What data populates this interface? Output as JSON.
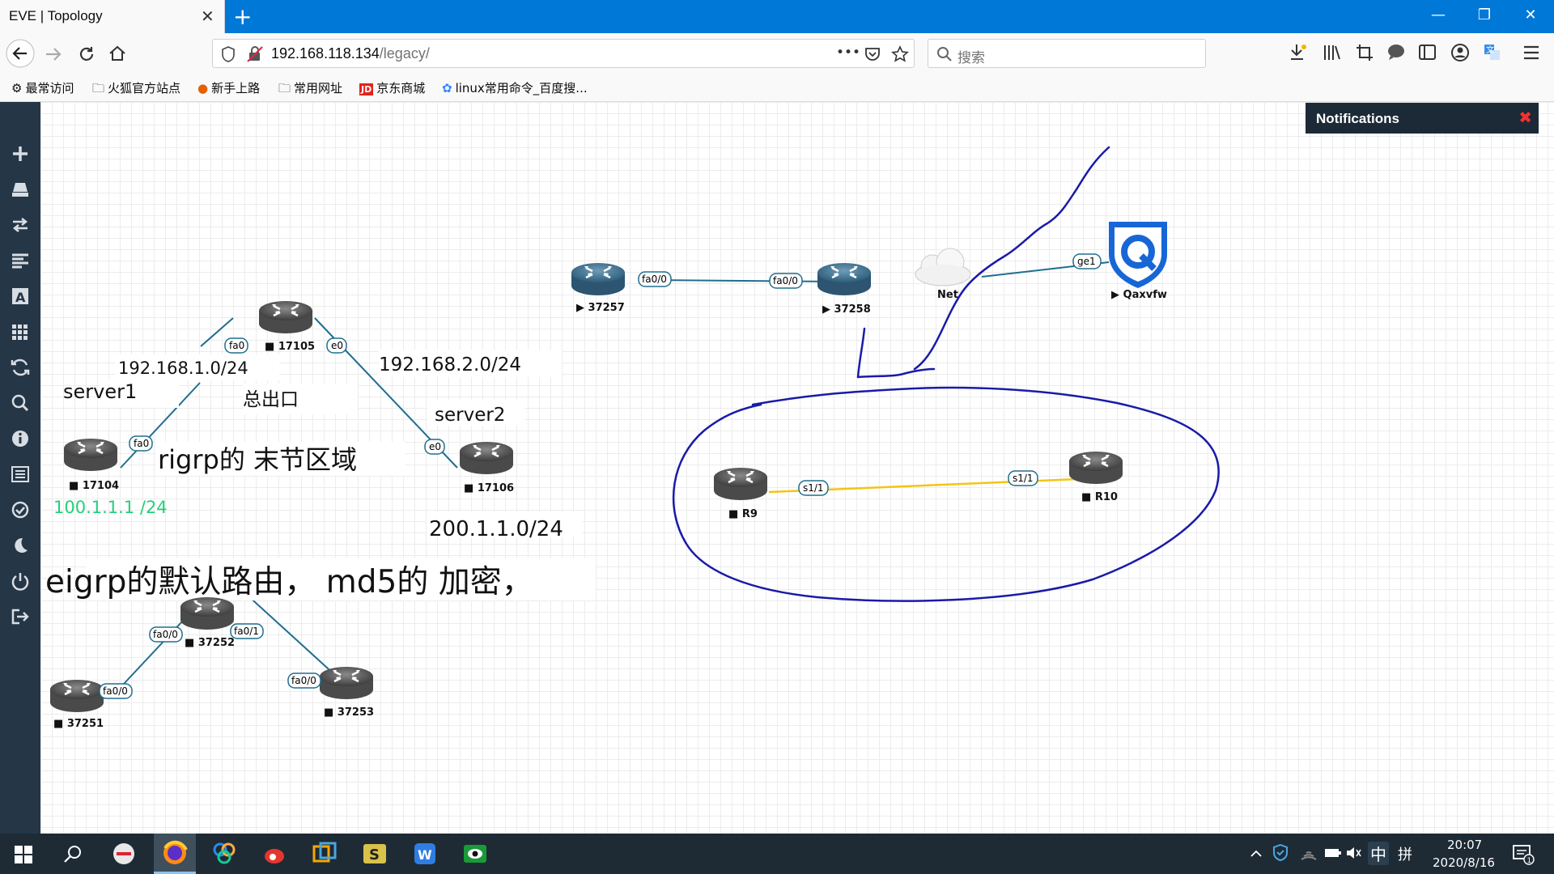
{
  "browser": {
    "tab_title": "EVE | Topology",
    "tab_close": "✕",
    "new_tab": "+",
    "url_host": "192.168.118.134",
    "url_path": "/legacy/",
    "url_more": "•••",
    "search_placeholder": "搜索",
    "window_minimize": "—",
    "window_restore": "❐",
    "window_close": "✕"
  },
  "bookmarks": [
    {
      "label": "最常访问",
      "icon": "gear-icon"
    },
    {
      "label": "火狐官方站点",
      "icon": "folder-icon"
    },
    {
      "label": "新手上路",
      "icon": "firefox-icon"
    },
    {
      "label": "常用网址",
      "icon": "folder-icon"
    },
    {
      "label": "京东商城",
      "icon": "jd-icon"
    },
    {
      "label": "linux常用命令_百度搜...",
      "icon": "baidu-paw-icon"
    }
  ],
  "notifications": {
    "title": "Notifications",
    "close": "✖"
  },
  "topology": {
    "nodes": {
      "n17105": "17105",
      "n17104": "17104",
      "n17106": "17106",
      "n37257": "37257",
      "n37258": "37258",
      "net": "Net",
      "qaxvfw": "Qaxvfw",
      "r9": "R9",
      "r10": "R10",
      "n37251": "37251",
      "n37252": "37252",
      "n37253": "37253"
    },
    "interfaces": {
      "fa0_17105": "fa0",
      "e0_17105": "e0",
      "fa0_17104": "fa0",
      "e0_17106": "e0",
      "fa00_37257": "fa0/0",
      "fa00_37258": "fa0/0",
      "ge1": "ge1",
      "s11_r9": "s1/1",
      "s11_r10": "s1/1",
      "fa00_37252": "fa0/0",
      "fa01_37252": "fa0/1",
      "fa00_37253": "fa0/0",
      "fa00_37251": "fa0/0"
    },
    "annotations": {
      "net1": "192.168.1.0/24",
      "server1": "server1",
      "exit": "总出口",
      "net2": "192.168.2.0/24",
      "server2": "server2",
      "stub": "rigrp的 末节区域",
      "lo": "100.1.1.1 /24",
      "net3": "200.1.1.0/24",
      "eigrp": "eigrp的默认路由，  md5的 加密，"
    }
  },
  "taskbar": {
    "ime": "中",
    "ime_mode": "拼",
    "time": "20:07",
    "date": "2020/8/16",
    "notif_count": "1"
  },
  "colors": {
    "titlebar": "#0078d7",
    "sidebar": "#253646",
    "taskbar": "#1e2b35",
    "link": "#1f6e8f",
    "serial": "#f3c514",
    "ink": "#1a1aa8",
    "green_text": "#22d07a"
  }
}
